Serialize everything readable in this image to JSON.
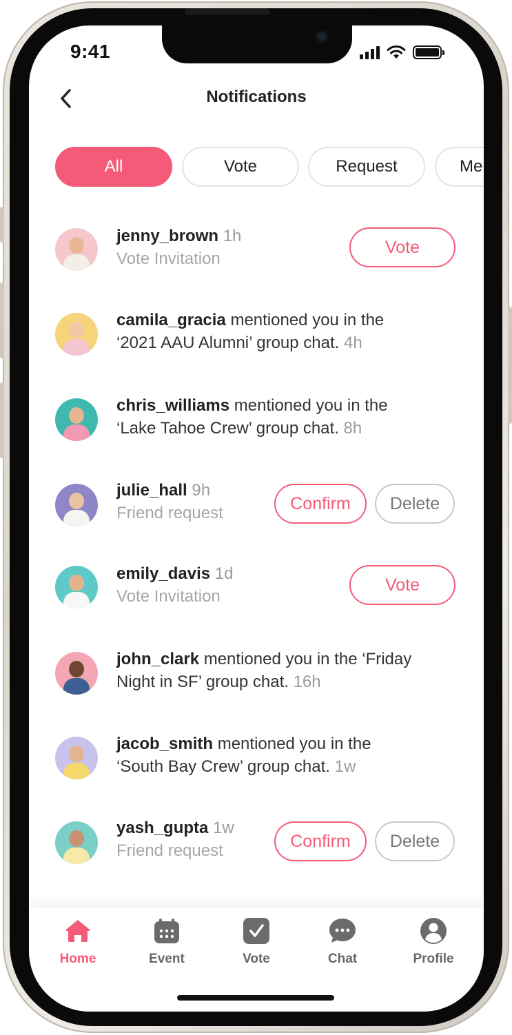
{
  "status_bar": {
    "time": "9:41"
  },
  "header": {
    "title": "Notifications"
  },
  "filters": [
    {
      "label": "All",
      "active": true
    },
    {
      "label": "Vote",
      "active": false
    },
    {
      "label": "Request",
      "active": false
    },
    {
      "label": "Mentions",
      "active": false
    }
  ],
  "notifications": [
    {
      "user": "jenny_brown",
      "time": "1h",
      "subtitle": "Vote Invitation",
      "action": "Vote",
      "avatar_bg": "#f5c6cc",
      "skin": "#e8b896",
      "shirt": "#f3efe8"
    },
    {
      "user": "camila_gracia",
      "line1_rest": " mentioned you in the",
      "line2": "‘2021 AAU Alumni’ group chat.",
      "time": "4h",
      "avatar_bg": "#f7d37c",
      "skin": "#f0c9a8",
      "shirt": "#f4c6d2"
    },
    {
      "user": "chris_williams",
      "line1_rest": " mentioned you in the",
      "line2": "‘Lake Tahoe Crew’ group chat.",
      "time": "8h",
      "avatar_bg": "#3fb8b0",
      "skin": "#e5b690",
      "shirt": "#f29ab4"
    },
    {
      "user": "julie_hall",
      "time": "9h",
      "subtitle": "Friend request",
      "confirm": "Confirm",
      "delete": "Delete",
      "avatar_bg": "#8f86c7",
      "skin": "#e9c2a4",
      "shirt": "#f7f5f2"
    },
    {
      "user": "emily_davis",
      "time": "1d",
      "subtitle": "Vote Invitation",
      "action": "Vote",
      "avatar_bg": "#5ec9c6",
      "skin": "#e3b38d",
      "shirt": "#f7f7f7"
    },
    {
      "user": "john_clark",
      "line1_rest": " mentioned you in the ‘Friday",
      "line2": "Night in SF’ group chat.",
      "time": "16h",
      "avatar_bg": "#f2a7b3",
      "skin": "#6e4631",
      "shirt": "#3d5f93"
    },
    {
      "user": "jacob_smith",
      "line1_rest": " mentioned you in the",
      "line2": "‘South Bay Crew’ group chat.",
      "time": "1w",
      "avatar_bg": "#c9c3ec",
      "skin": "#e4b48e",
      "shirt": "#f5d86a"
    },
    {
      "user": "yash_gupta",
      "time": "1w",
      "subtitle": "Friend request",
      "confirm": "Confirm",
      "delete": "Delete",
      "avatar_bg": "#7ccfc6",
      "skin": "#c89270",
      "shirt": "#f7e9a8"
    }
  ],
  "tabbar": [
    {
      "label": "Home",
      "icon": "home-icon",
      "active": true
    },
    {
      "label": "Event",
      "icon": "calendar-icon",
      "active": false
    },
    {
      "label": "Vote",
      "icon": "vote-check-icon",
      "active": false
    },
    {
      "label": "Chat",
      "icon": "chat-bubble-icon",
      "active": false
    },
    {
      "label": "Profile",
      "icon": "profile-icon",
      "active": false
    }
  ],
  "colors": {
    "accent": "#f45b78",
    "icon_grey": "#6b6b6b"
  }
}
